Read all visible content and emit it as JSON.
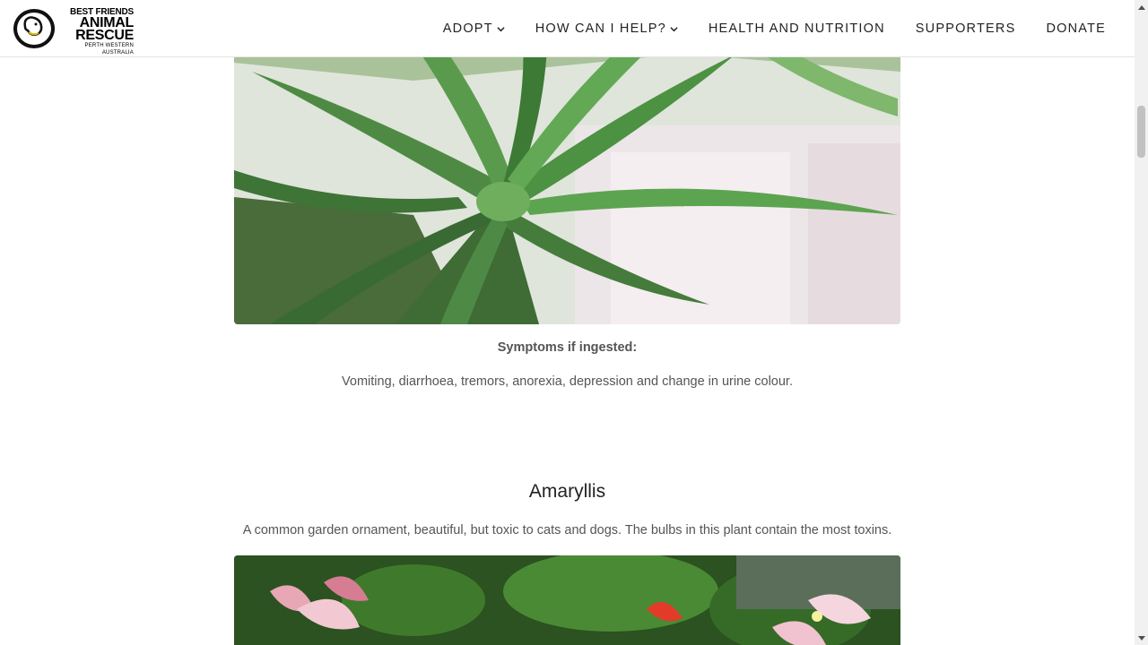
{
  "header": {
    "logo": {
      "line1": "BEST FRIENDS",
      "line2": "ANIMAL",
      "line3": "RESCUE",
      "line4": "PERTH WESTERN AUSTRALIA"
    },
    "nav": [
      {
        "label": "ADOPT",
        "has_dropdown": true
      },
      {
        "label": "HOW CAN I HELP?",
        "has_dropdown": true
      },
      {
        "label": "HEALTH AND NUTRITION",
        "has_dropdown": false
      },
      {
        "label": "SUPPORTERS",
        "has_dropdown": false
      },
      {
        "label": "DONATE",
        "has_dropdown": false
      }
    ]
  },
  "aloe": {
    "symptoms_label": "Symptoms if ingested:",
    "symptoms_text": "Vomiting, diarrhoea, tremors, anorexia, depression and change in urine colour."
  },
  "amaryllis": {
    "title": "Amaryllis",
    "description": "A common garden ornament, beautiful, but toxic to cats and dogs. The bulbs in this plant contain the most toxins."
  },
  "icons": {
    "dropdown": "chevron-down-icon",
    "scroll_up": "arrow-up-icon",
    "scroll_down": "arrow-down-icon"
  },
  "colors": {
    "nav_text": "#222222",
    "body_text": "#555555",
    "header_border": "#e3e3e3"
  }
}
